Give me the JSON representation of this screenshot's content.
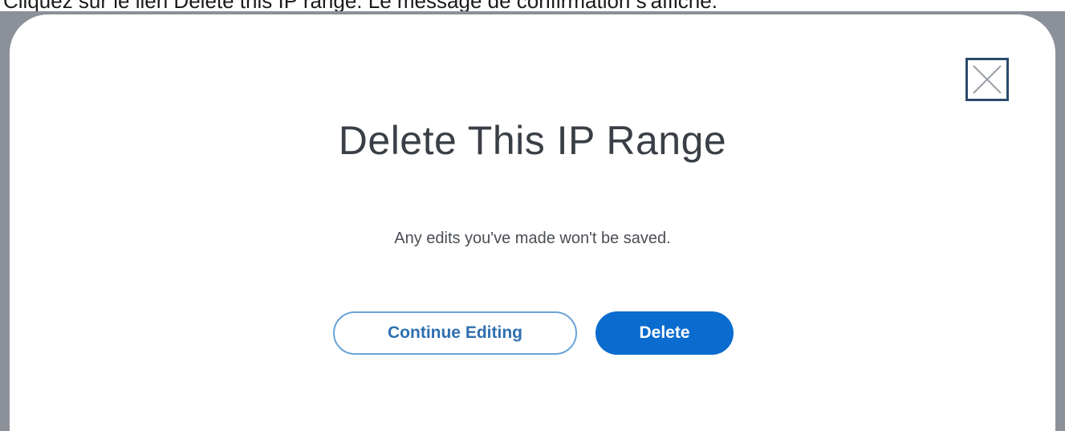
{
  "caption": "Cliquez sur le lien Delete this IP range. Le message de confirmation s'affiche.",
  "dialog": {
    "title": "Delete This IP Range",
    "message": "Any edits you've made won't be saved.",
    "close_icon": "close-icon",
    "buttons": {
      "continue_label": "Continue Editing",
      "delete_label": "Delete"
    }
  },
  "colors": {
    "primary": "#0a6ccf",
    "secondary_border": "#6aa3d9",
    "frame": "#8c9098"
  }
}
